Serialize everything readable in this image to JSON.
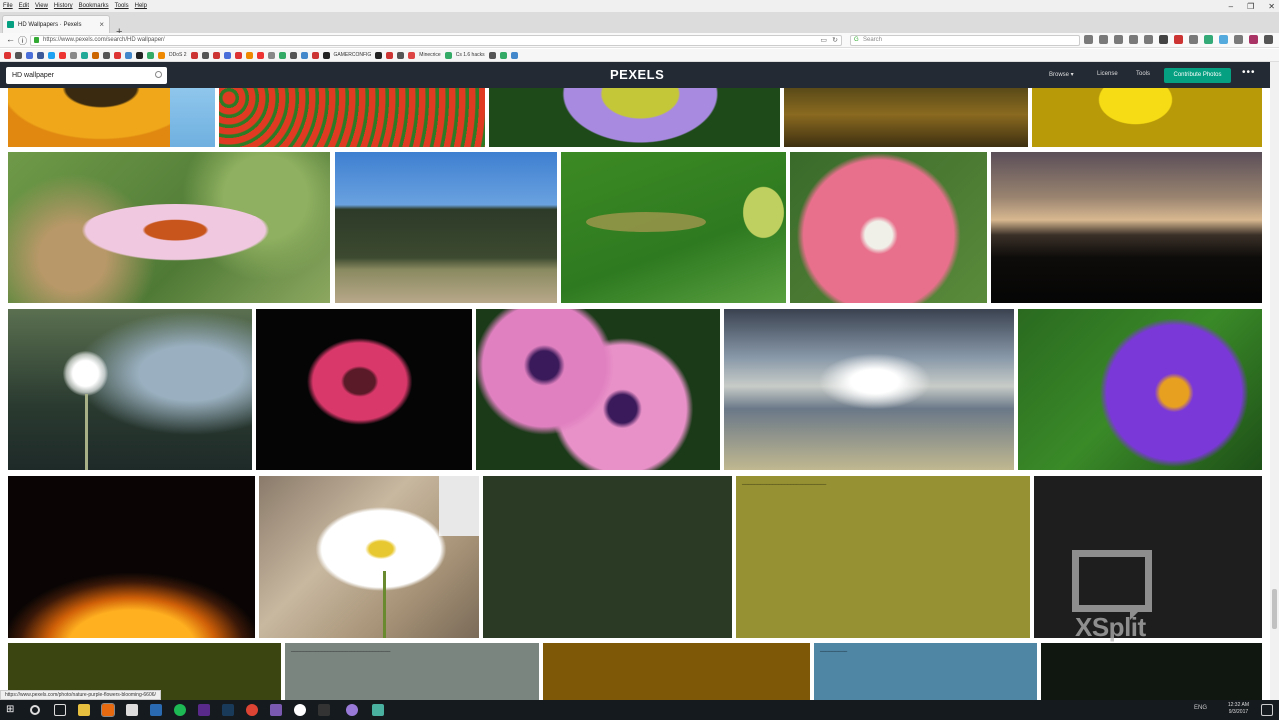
{
  "menubar": [
    "File",
    "Edit",
    "View",
    "History",
    "Bookmarks",
    "Tools",
    "Help"
  ],
  "tab": {
    "title": "HD Wallpapers · Pexels"
  },
  "nav": {
    "url": "https://www.pexels.com/search/HD wallpaper/",
    "search_placeholder": "Search"
  },
  "bookmarks": [
    {
      "label": "DDoS 2",
      "color": "#cc3333"
    },
    {
      "label": "GAMERCONFIG",
      "color": "#333333"
    },
    {
      "label": "Minecrice",
      "color": "#d44"
    },
    {
      "label": "Cs 1.6 hacks",
      "color": "#3a6"
    }
  ],
  "pexels": {
    "search_value": "HD wallpaper",
    "logo": "PEXELS",
    "browse": "Browse ▾",
    "license": "License",
    "tools": "Tools",
    "contribute": "Contribute Photos",
    "more": "•••"
  },
  "status_url": "https://www.pexels.com/photo/nature-purple-flowers-blooming-6606/",
  "watermark": "XSplit",
  "clock": {
    "time": "12:32 AM",
    "date": "9/3/2017"
  },
  "tray": {
    "lang": "ENG"
  },
  "colors": {
    "accent": "#05a081",
    "header": "#232a34"
  }
}
